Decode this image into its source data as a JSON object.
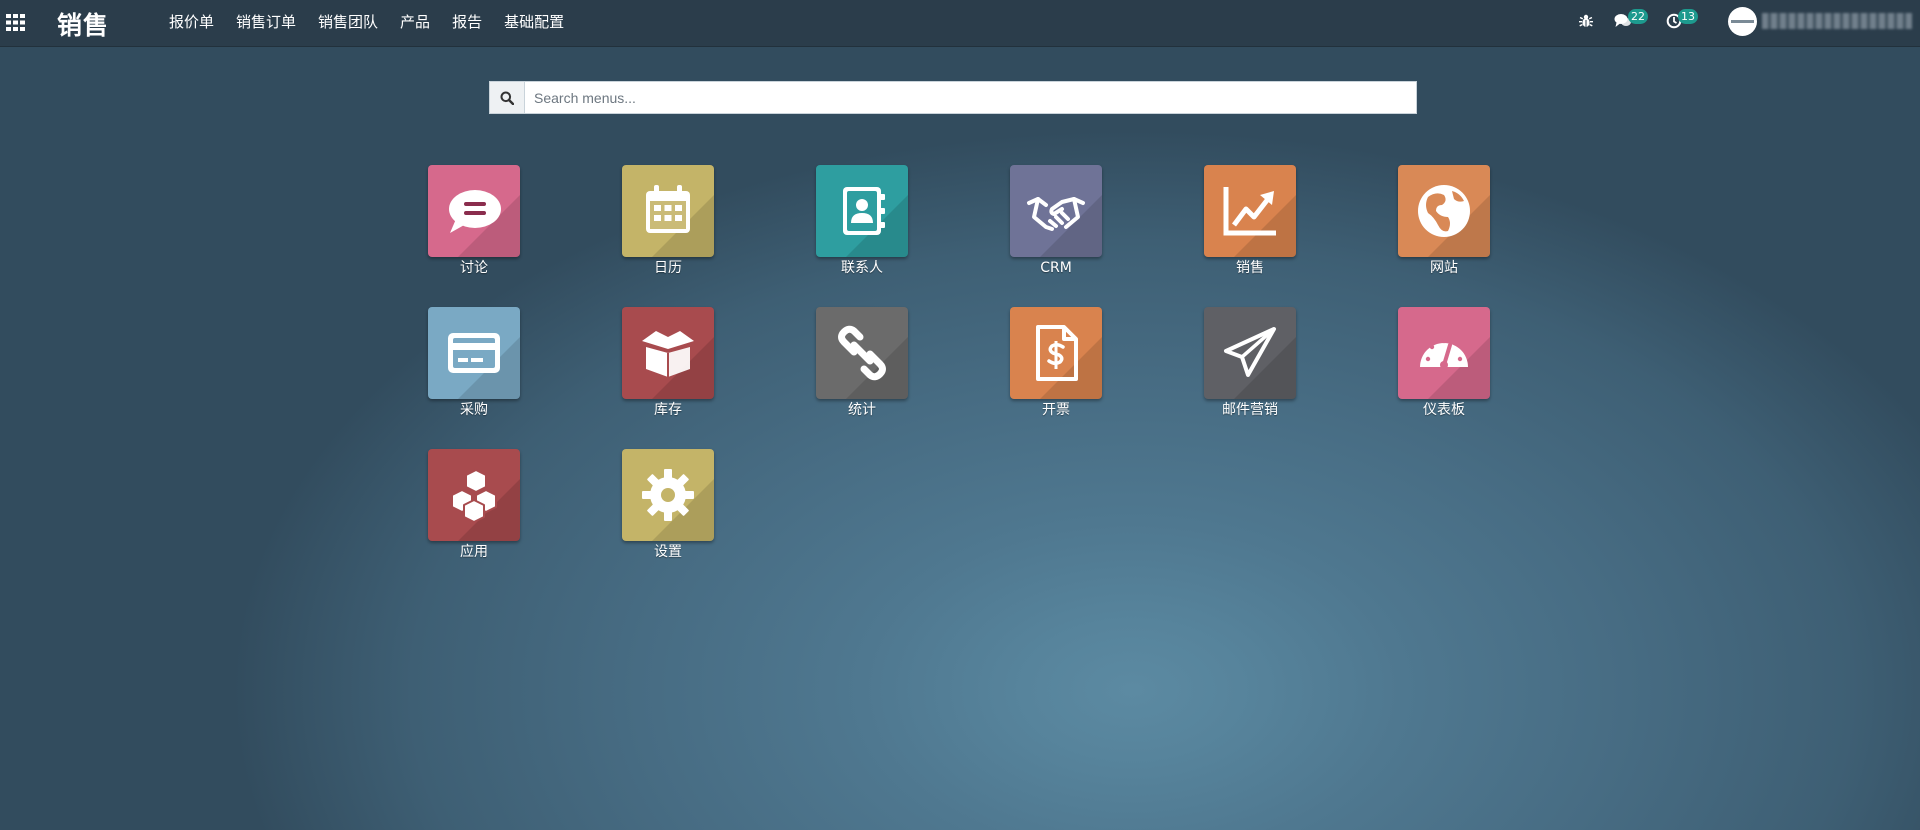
{
  "navbar": {
    "brand": "销售",
    "menu": [
      "报价单",
      "销售订单",
      "销售团队",
      "产品",
      "报告",
      "基础配置"
    ],
    "messages_count": "22",
    "activities_count": "13"
  },
  "search": {
    "placeholder": "Search menus..."
  },
  "apps": [
    {
      "label": "讨论",
      "color": "#d6698c",
      "icon": "chat-bubble-icon"
    },
    {
      "label": "日历",
      "color": "#c4b468",
      "icon": "calendar-icon"
    },
    {
      "label": "联系人",
      "color": "#2e9ea0",
      "icon": "address-book-icon"
    },
    {
      "label": "CRM",
      "color": "#6f7397",
      "icon": "handshake-icon"
    },
    {
      "label": "销售",
      "color": "#d9834e",
      "icon": "line-chart-icon"
    },
    {
      "label": "网站",
      "color": "#d98956",
      "icon": "globe-icon"
    },
    {
      "label": "采购",
      "color": "#7aa9c4",
      "icon": "credit-card-icon"
    },
    {
      "label": "库存",
      "color": "#a84b4e",
      "icon": "box-icon"
    },
    {
      "label": "统计",
      "color": "#6b6b6b",
      "icon": "link-icon"
    },
    {
      "label": "开票",
      "color": "#d9834e",
      "icon": "invoice-dollar-icon"
    },
    {
      "label": "邮件营销",
      "color": "#5f6065",
      "icon": "paper-plane-icon"
    },
    {
      "label": "仪表板",
      "color": "#d6698c",
      "icon": "gauge-icon"
    },
    {
      "label": "应用",
      "color": "#a84b4e",
      "icon": "cubes-icon"
    },
    {
      "label": "设置",
      "color": "#c4b468",
      "icon": "gear-icon"
    }
  ]
}
